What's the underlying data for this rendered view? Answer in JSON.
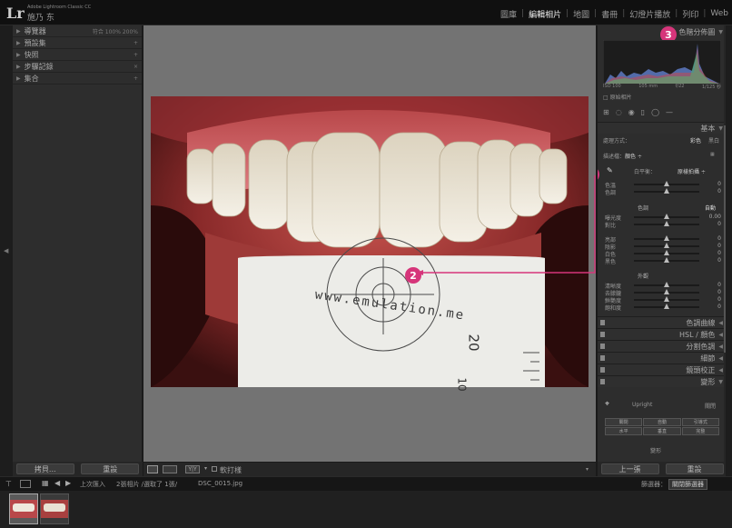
{
  "app": {
    "logo": "Lr",
    "product": "Adobe Lightroom Classic CC",
    "user": "施乃 东"
  },
  "modules": [
    {
      "label": "圖庫",
      "active": false
    },
    {
      "label": "編輯相片",
      "active": true
    },
    {
      "label": "地圖",
      "active": false
    },
    {
      "label": "書冊",
      "active": false
    },
    {
      "label": "幻燈片播放",
      "active": false
    },
    {
      "label": "列印",
      "active": false
    },
    {
      "label": "Web",
      "active": false
    }
  ],
  "left_panel": {
    "rows": [
      {
        "label": "導覽器",
        "right": "符合 100% 200%"
      },
      {
        "label": "預設集",
        "right": "+"
      },
      {
        "label": "快照",
        "right": "+"
      },
      {
        "label": "步驟記錄",
        "right": "×"
      },
      {
        "label": "集合",
        "right": "+"
      }
    ],
    "copy_button": "拷貝...",
    "reset_button": "重設"
  },
  "toolbar": {
    "soft_proof": "軟打樣"
  },
  "photo": {
    "card_text": "www.emulation.me",
    "ruler_numbers": [
      "20",
      "10"
    ]
  },
  "right_panel": {
    "histogram_title": "色階分佈圖",
    "histogram_readouts": [
      "ISO 100",
      "105 mm",
      "f/22",
      "1/125 秒"
    ],
    "original_photo": "原始相片",
    "basic_title": "基本",
    "treatment_label": "處理方式：",
    "treatment_color": "彩色",
    "treatment_bw": "黑白",
    "profile_label": "描述檔：",
    "profile_value": "顏色 ÷",
    "wb_label": "白平衡：",
    "wb_value": "原樣拍攝 ÷",
    "wb_sliders": [
      {
        "label": "色溫",
        "value": "0",
        "pos": 0.5
      },
      {
        "label": "色調",
        "value": "0",
        "pos": 0.5
      }
    ],
    "tone_label": "色調",
    "auto_label": "自動",
    "tone_sliders": [
      {
        "label": "曝光度",
        "value": "0.00",
        "pos": 0.5
      },
      {
        "label": "對比",
        "value": "0",
        "pos": 0.5
      },
      {
        "label": "亮部",
        "value": "0",
        "pos": 0.5
      },
      {
        "label": "陰影",
        "value": "0",
        "pos": 0.5
      },
      {
        "label": "白色",
        "value": "0",
        "pos": 0.5
      },
      {
        "label": "黑色",
        "value": "0",
        "pos": 0.5
      }
    ],
    "presence_label": "外觀",
    "presence_sliders": [
      {
        "label": "清晰度",
        "value": "0",
        "pos": 0.5
      },
      {
        "label": "去朦朧",
        "value": "0",
        "pos": 0.5
      },
      {
        "label": "鮮艷度",
        "value": "0",
        "pos": 0.5
      },
      {
        "label": "飽和度",
        "value": "0",
        "pos": 0.5
      }
    ],
    "sections": [
      "色調曲線",
      "HSL / 顏色",
      "分割色調",
      "細節",
      "鏡頭校正",
      "變形"
    ],
    "transform_upright": "Upright",
    "transform_off": "關閉",
    "upright_buttons": [
      "關閉",
      "自動",
      "引導式",
      "水平",
      "垂直",
      "完整"
    ],
    "transform_footer": "變形",
    "prev_button": "上一張",
    "reset_button": "重設"
  },
  "filmstrip_bar": {
    "source": "上次匯入",
    "count": "2張相片 /選取了 1張/",
    "filename": "DSC_0015.jpg",
    "filter_label": "篩選器：",
    "filter_value": "關閉篩選器"
  },
  "badges": {
    "one": "1",
    "two": "2",
    "three": "3"
  },
  "colors": {
    "badge": "#d6357a",
    "panel": "#2d2d2d",
    "canvas": "#737373"
  }
}
